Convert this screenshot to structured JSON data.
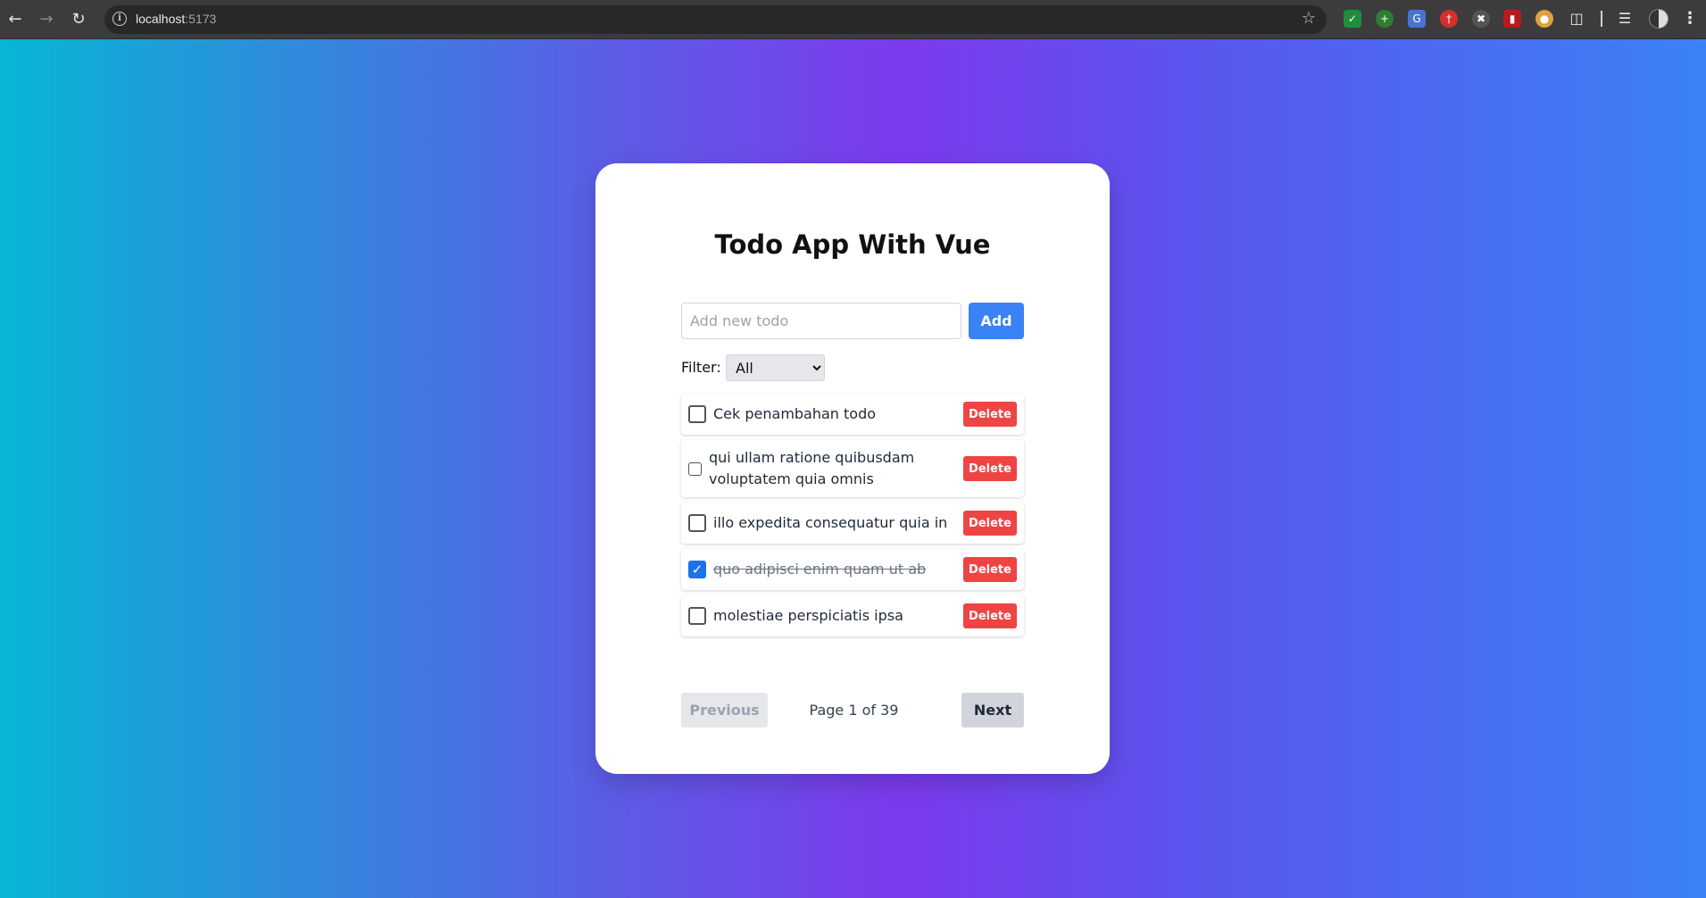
{
  "browser": {
    "url_host": "localhost",
    "url_port": ":5173",
    "back_icon": "arrow-left-icon",
    "forward_icon": "arrow-right-icon",
    "reload_icon": "reload-icon"
  },
  "app": {
    "title": "Todo App With Vue",
    "new_todo_placeholder": "Add new todo",
    "new_todo_value": "",
    "add_label": "Add",
    "filter_label": "Filter:",
    "filter_selected": "All",
    "delete_label": "Delete",
    "todos": [
      {
        "text": "Cek penambahan todo",
        "completed": false
      },
      {
        "text": "qui ullam ratione quibusdam voluptatem quia omnis",
        "completed": false
      },
      {
        "text": "illo expedita consequatur quia in",
        "completed": false
      },
      {
        "text": "quo adipisci enim quam ut ab",
        "completed": true
      },
      {
        "text": "molestiae perspiciatis ipsa",
        "completed": false
      }
    ],
    "pagination": {
      "previous_label": "Previous",
      "page_text": "Page 1 of 39",
      "next_label": "Next"
    }
  },
  "colors": {
    "primary": "#3b82f6",
    "danger": "#ef4444",
    "checked": "#1a73e8"
  }
}
